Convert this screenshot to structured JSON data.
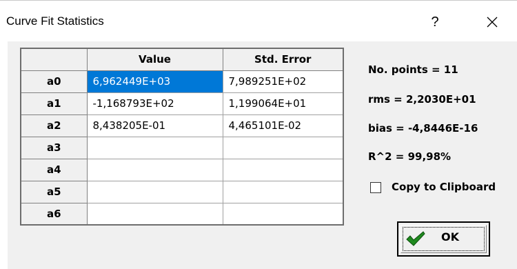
{
  "window": {
    "title": "Curve Fit Statistics",
    "help_label": "?"
  },
  "table": {
    "headers": [
      "",
      "Value",
      "Std. Error"
    ],
    "rows": [
      {
        "label": "a0",
        "value": "6,962449E+03",
        "std_error": "7,989251E+02"
      },
      {
        "label": "a1",
        "value": "-1,168793E+02",
        "std_error": "1,199064E+01"
      },
      {
        "label": "a2",
        "value": "8,438205E-01",
        "std_error": "4,465101E-02"
      },
      {
        "label": "a3",
        "value": "",
        "std_error": ""
      },
      {
        "label": "a4",
        "value": "",
        "std_error": ""
      },
      {
        "label": "a5",
        "value": "",
        "std_error": ""
      },
      {
        "label": "a6",
        "value": "",
        "std_error": ""
      }
    ],
    "selected_cell": "a0.value"
  },
  "stats": {
    "points": "No. points = 11",
    "rms": "rms = 2,2030E+01",
    "bias": "bias = -4,8446E-16",
    "r2": "R^2 = 99,98%"
  },
  "copy_to_clipboard": {
    "label": "Copy to Clipboard",
    "checked": false
  },
  "ok_button": {
    "label": "OK",
    "icon": "checkmark-icon"
  },
  "colors": {
    "selection": "#0078d7",
    "check_green": "#1f8a1f"
  }
}
